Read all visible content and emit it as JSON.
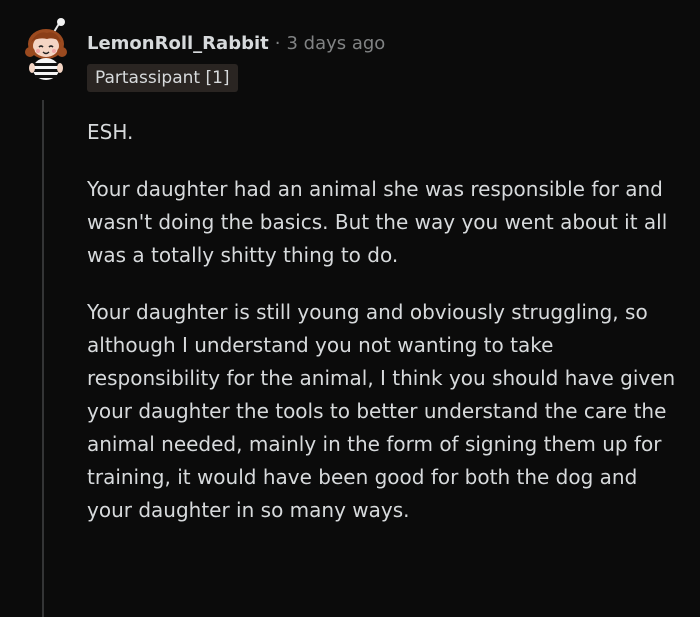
{
  "comment": {
    "author": "LemonRoll_Rabbit",
    "separator": "·",
    "timestamp": "3 days ago",
    "flair": "Partassipant [1]",
    "paragraphs": [
      "ESH.",
      "Your daughter had an animal she was responsible for and wasn't doing the basics. But the way you went about it all was a totally shitty thing to do.",
      "Your daughter is still young and obviously struggling, so although I understand you not wanting to take responsibility for the animal, I think you should have given your daughter the tools to better understand the care the animal needed, mainly in the form of signing them up for training, it would have been good for both the dog and your daughter in so many ways."
    ]
  },
  "colors": {
    "background": "#0b0b0b",
    "text": "#d7dadc",
    "muted": "#818384",
    "flair_bg": "#2a2522",
    "thread_line": "#343536"
  },
  "icons": {
    "avatar": "snoo-avatar-icon"
  }
}
